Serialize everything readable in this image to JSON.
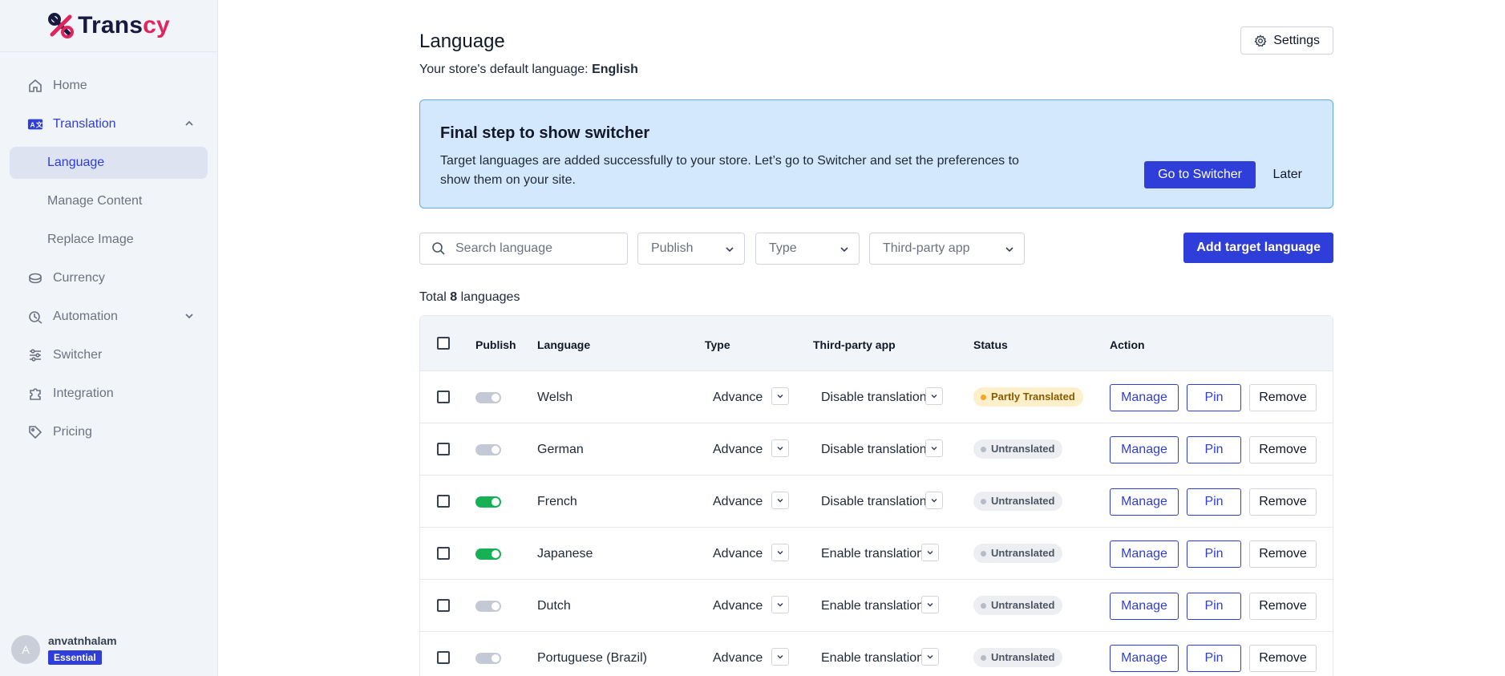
{
  "brand": {
    "name_main": "Trans",
    "name_accent": "cy",
    "accent_color": "#e0245e",
    "primary_color": "#2f3ed8"
  },
  "sidebar": {
    "items": [
      {
        "label": "Home",
        "icon": "home-icon"
      },
      {
        "label": "Translation",
        "icon": "translate-icon",
        "expanded": true,
        "children": [
          {
            "label": "Language",
            "active": true
          },
          {
            "label": "Manage Content"
          },
          {
            "label": "Replace Image"
          }
        ]
      },
      {
        "label": "Currency",
        "icon": "currency-icon"
      },
      {
        "label": "Automation",
        "icon": "automation-icon"
      },
      {
        "label": "Switcher",
        "icon": "sliders-icon"
      },
      {
        "label": "Integration",
        "icon": "puzzle-icon"
      },
      {
        "label": "Pricing",
        "icon": "tag-icon"
      }
    ]
  },
  "user": {
    "initial": "A",
    "name": "anvatnhalam",
    "plan": "Essential"
  },
  "header": {
    "title": "Language",
    "subtitle_prefix": "Your store's default language:",
    "default_language": "English",
    "settings_label": "Settings"
  },
  "banner": {
    "title": "Final step to show switcher",
    "text": "Target languages are added successfully to your store. Let’s go to Switcher and set the preferences to show them on your site.",
    "primary_label": "Go to Switcher",
    "secondary_label": "Later"
  },
  "toolbar": {
    "search_placeholder": "Search language",
    "filters": [
      "Publish",
      "Type",
      "Third-party app"
    ],
    "add_label": "Add target language"
  },
  "summary": {
    "prefix": "Total",
    "count": "8",
    "suffix": "languages"
  },
  "table": {
    "columns": [
      "Publish",
      "Language",
      "Type",
      "Third-party app",
      "Status",
      "Action"
    ],
    "rows": [
      {
        "published": false,
        "language": "Welsh",
        "type": "Advance",
        "third_party": "Disable translation",
        "status": "Partly Translated"
      },
      {
        "published": false,
        "language": "German",
        "type": "Advance",
        "third_party": "Disable translation",
        "status": "Untranslated"
      },
      {
        "published": true,
        "language": "French",
        "type": "Advance",
        "third_party": "Disable translation",
        "status": "Untranslated"
      },
      {
        "published": true,
        "language": "Japanese",
        "type": "Advance",
        "third_party": "Enable translation",
        "status": "Untranslated"
      },
      {
        "published": false,
        "language": "Dutch",
        "type": "Advance",
        "third_party": "Enable translation",
        "status": "Untranslated"
      },
      {
        "published": false,
        "language": "Portuguese (Brazil)",
        "type": "Advance",
        "third_party": "Enable translation",
        "status": "Untranslated"
      }
    ],
    "actions": {
      "manage": "Manage",
      "pin": "Pin",
      "remove": "Remove"
    }
  }
}
